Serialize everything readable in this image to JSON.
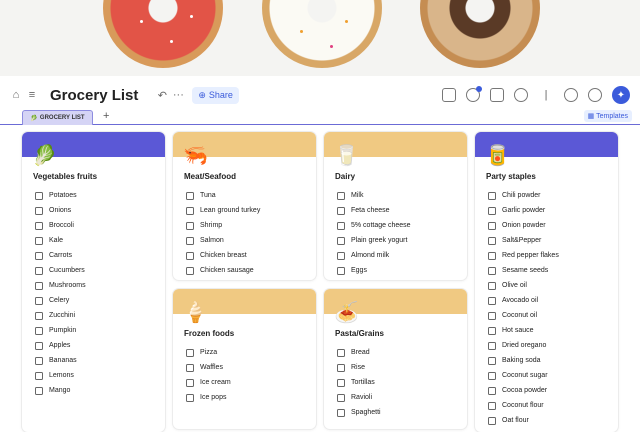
{
  "toolbar": {
    "title": "Grocery List",
    "share_label": "Share",
    "undo_glyph": "↶",
    "more_glyph": "···"
  },
  "tabs": {
    "active": "GROCERY LIST",
    "add_label": "+",
    "templates_label": "Templates"
  },
  "colors": {
    "purple": "#5b58d6",
    "tan": "#f0c982",
    "accent": "#3b5bdb"
  },
  "cards": {
    "veg": {
      "title": "Vegetables fruits",
      "icon": "leafy-greens-icon",
      "emoji": "🥬",
      "items": [
        "Potatoes",
        "Onions",
        "Broccoli",
        "Kale",
        "Carrots",
        "Cucumbers",
        "Mushrooms",
        "Celery",
        "Zucchini",
        "Pumpkin",
        "Apples",
        "Bananas",
        "Lemons",
        "Mango"
      ]
    },
    "meat": {
      "title": "Meat/Seafood",
      "icon": "shrimp-icon",
      "emoji": "🦐",
      "items": [
        "Tuna",
        "Lean ground turkey",
        "Shrimp",
        "Salmon",
        "Chicken breast",
        "Chicken sausage"
      ]
    },
    "dairy": {
      "title": "Dairy",
      "icon": "milk-glass-icon",
      "emoji": "🥛",
      "items": [
        "Milk",
        "Feta cheese",
        "5% cottage cheese",
        "Plain greek yogurt",
        "Almond milk",
        "Eggs"
      ]
    },
    "party": {
      "title": "Party staples",
      "icon": "can-icon",
      "emoji": "🥫",
      "items": [
        "Chili powder",
        "Garlic powder",
        "Onion powder",
        "Salt&Pepper",
        "Red pepper flakes",
        "Sesame seeds",
        "Olive oil",
        "Avocado oil",
        "Coconut oil",
        "Hot sauce",
        "Dried oregano",
        "Baking soda",
        "Coconut sugar",
        "Cocoa powder",
        "Coconut flour",
        "Oat flour"
      ]
    },
    "frozen": {
      "title": "Frozen foods",
      "icon": "ice-cream-icon",
      "emoji": "🍦",
      "items": [
        "Pizza",
        "Waffles",
        "Ice cream",
        "Ice pops"
      ]
    },
    "pasta": {
      "title": "Pasta/Grains",
      "icon": "pasta-bowl-icon",
      "emoji": "🍝",
      "items": [
        "Bread",
        "Rise",
        "Tortillas",
        "Ravioli",
        "Spaghetti"
      ]
    }
  }
}
